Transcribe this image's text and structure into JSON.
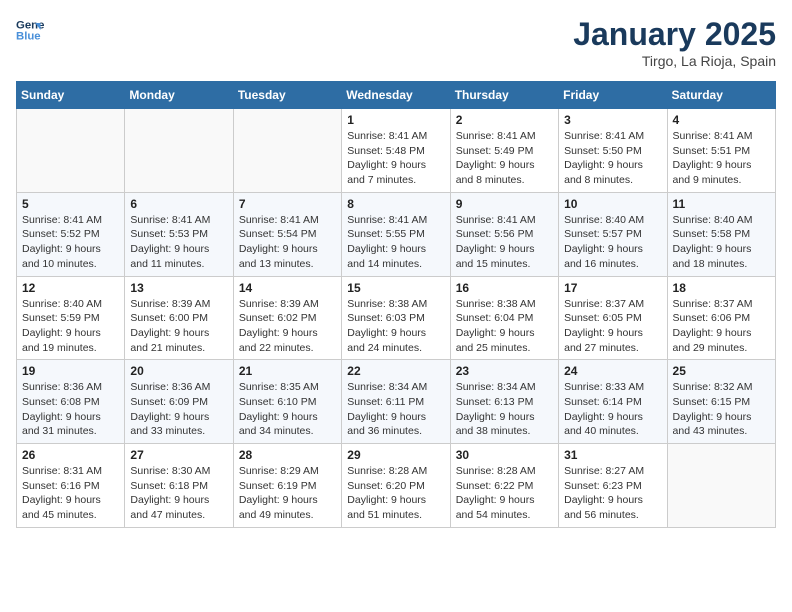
{
  "logo": {
    "line1": "General",
    "line2": "Blue"
  },
  "title": "January 2025",
  "subtitle": "Tirgo, La Rioja, Spain",
  "weekdays": [
    "Sunday",
    "Monday",
    "Tuesday",
    "Wednesday",
    "Thursday",
    "Friday",
    "Saturday"
  ],
  "weeks": [
    [
      {
        "day": "",
        "info": ""
      },
      {
        "day": "",
        "info": ""
      },
      {
        "day": "",
        "info": ""
      },
      {
        "day": "1",
        "info": "Sunrise: 8:41 AM\nSunset: 5:48 PM\nDaylight: 9 hours and 7 minutes."
      },
      {
        "day": "2",
        "info": "Sunrise: 8:41 AM\nSunset: 5:49 PM\nDaylight: 9 hours and 8 minutes."
      },
      {
        "day": "3",
        "info": "Sunrise: 8:41 AM\nSunset: 5:50 PM\nDaylight: 9 hours and 8 minutes."
      },
      {
        "day": "4",
        "info": "Sunrise: 8:41 AM\nSunset: 5:51 PM\nDaylight: 9 hours and 9 minutes."
      }
    ],
    [
      {
        "day": "5",
        "info": "Sunrise: 8:41 AM\nSunset: 5:52 PM\nDaylight: 9 hours and 10 minutes."
      },
      {
        "day": "6",
        "info": "Sunrise: 8:41 AM\nSunset: 5:53 PM\nDaylight: 9 hours and 11 minutes."
      },
      {
        "day": "7",
        "info": "Sunrise: 8:41 AM\nSunset: 5:54 PM\nDaylight: 9 hours and 13 minutes."
      },
      {
        "day": "8",
        "info": "Sunrise: 8:41 AM\nSunset: 5:55 PM\nDaylight: 9 hours and 14 minutes."
      },
      {
        "day": "9",
        "info": "Sunrise: 8:41 AM\nSunset: 5:56 PM\nDaylight: 9 hours and 15 minutes."
      },
      {
        "day": "10",
        "info": "Sunrise: 8:40 AM\nSunset: 5:57 PM\nDaylight: 9 hours and 16 minutes."
      },
      {
        "day": "11",
        "info": "Sunrise: 8:40 AM\nSunset: 5:58 PM\nDaylight: 9 hours and 18 minutes."
      }
    ],
    [
      {
        "day": "12",
        "info": "Sunrise: 8:40 AM\nSunset: 5:59 PM\nDaylight: 9 hours and 19 minutes."
      },
      {
        "day": "13",
        "info": "Sunrise: 8:39 AM\nSunset: 6:00 PM\nDaylight: 9 hours and 21 minutes."
      },
      {
        "day": "14",
        "info": "Sunrise: 8:39 AM\nSunset: 6:02 PM\nDaylight: 9 hours and 22 minutes."
      },
      {
        "day": "15",
        "info": "Sunrise: 8:38 AM\nSunset: 6:03 PM\nDaylight: 9 hours and 24 minutes."
      },
      {
        "day": "16",
        "info": "Sunrise: 8:38 AM\nSunset: 6:04 PM\nDaylight: 9 hours and 25 minutes."
      },
      {
        "day": "17",
        "info": "Sunrise: 8:37 AM\nSunset: 6:05 PM\nDaylight: 9 hours and 27 minutes."
      },
      {
        "day": "18",
        "info": "Sunrise: 8:37 AM\nSunset: 6:06 PM\nDaylight: 9 hours and 29 minutes."
      }
    ],
    [
      {
        "day": "19",
        "info": "Sunrise: 8:36 AM\nSunset: 6:08 PM\nDaylight: 9 hours and 31 minutes."
      },
      {
        "day": "20",
        "info": "Sunrise: 8:36 AM\nSunset: 6:09 PM\nDaylight: 9 hours and 33 minutes."
      },
      {
        "day": "21",
        "info": "Sunrise: 8:35 AM\nSunset: 6:10 PM\nDaylight: 9 hours and 34 minutes."
      },
      {
        "day": "22",
        "info": "Sunrise: 8:34 AM\nSunset: 6:11 PM\nDaylight: 9 hours and 36 minutes."
      },
      {
        "day": "23",
        "info": "Sunrise: 8:34 AM\nSunset: 6:13 PM\nDaylight: 9 hours and 38 minutes."
      },
      {
        "day": "24",
        "info": "Sunrise: 8:33 AM\nSunset: 6:14 PM\nDaylight: 9 hours and 40 minutes."
      },
      {
        "day": "25",
        "info": "Sunrise: 8:32 AM\nSunset: 6:15 PM\nDaylight: 9 hours and 43 minutes."
      }
    ],
    [
      {
        "day": "26",
        "info": "Sunrise: 8:31 AM\nSunset: 6:16 PM\nDaylight: 9 hours and 45 minutes."
      },
      {
        "day": "27",
        "info": "Sunrise: 8:30 AM\nSunset: 6:18 PM\nDaylight: 9 hours and 47 minutes."
      },
      {
        "day": "28",
        "info": "Sunrise: 8:29 AM\nSunset: 6:19 PM\nDaylight: 9 hours and 49 minutes."
      },
      {
        "day": "29",
        "info": "Sunrise: 8:28 AM\nSunset: 6:20 PM\nDaylight: 9 hours and 51 minutes."
      },
      {
        "day": "30",
        "info": "Sunrise: 8:28 AM\nSunset: 6:22 PM\nDaylight: 9 hours and 54 minutes."
      },
      {
        "day": "31",
        "info": "Sunrise: 8:27 AM\nSunset: 6:23 PM\nDaylight: 9 hours and 56 minutes."
      },
      {
        "day": "",
        "info": ""
      }
    ]
  ]
}
